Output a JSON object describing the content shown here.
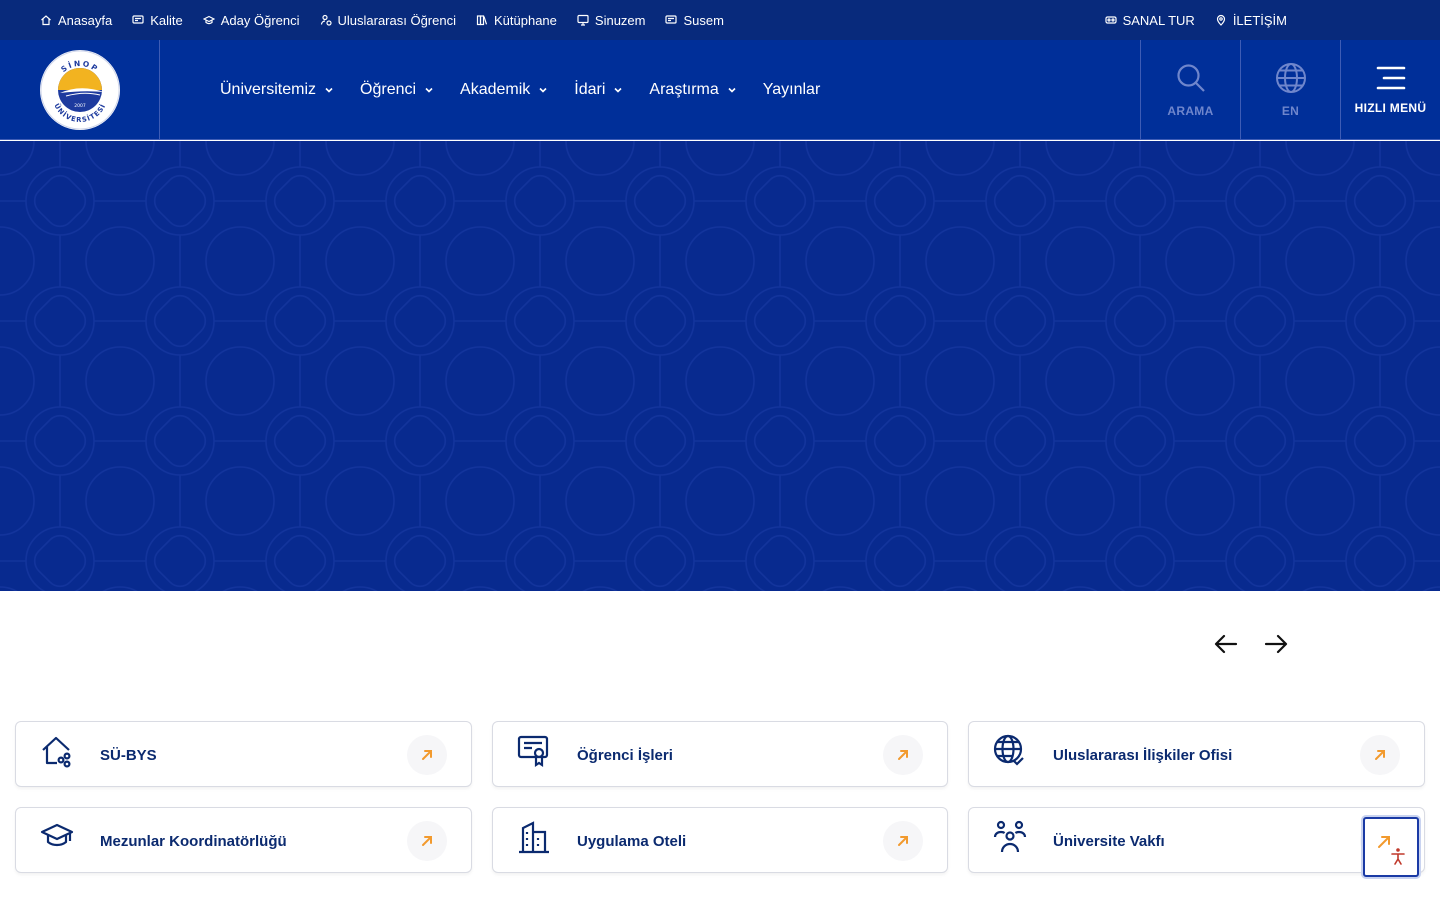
{
  "topbar": {
    "left": [
      {
        "label": "Anasayfa",
        "icon": "home-icon"
      },
      {
        "label": "Kalite",
        "icon": "certificate-icon"
      },
      {
        "label": "Aday Öğrenci",
        "icon": "graduation-cap-icon"
      },
      {
        "label": "Uluslararası Öğrenci",
        "icon": "user-globe-icon"
      },
      {
        "label": "Kütüphane",
        "icon": "books-icon"
      },
      {
        "label": "Sinuzem",
        "icon": "monitor-icon"
      },
      {
        "label": "Susem",
        "icon": "certificate-icon"
      }
    ],
    "right": [
      {
        "label": "SANAL TUR",
        "icon": "vr-glasses-icon"
      },
      {
        "label": "İLETİŞİM",
        "icon": "location-pin-icon"
      }
    ]
  },
  "header": {
    "logo": {
      "top_text": "SİNOP",
      "bottom_text": "ÜNİVERSİTESİ",
      "year": "2007"
    },
    "nav": [
      {
        "label": "Üniversitemiz",
        "has_dropdown": true
      },
      {
        "label": "Öğrenci",
        "has_dropdown": true
      },
      {
        "label": "Akademik",
        "has_dropdown": true
      },
      {
        "label": "İdari",
        "has_dropdown": true
      },
      {
        "label": "Araştırma",
        "has_dropdown": true
      },
      {
        "label": "Yayınlar",
        "has_dropdown": false
      }
    ],
    "search_label": "ARAMA",
    "lang_label": "EN",
    "menu_label": "HIZLI MENÜ"
  },
  "colors": {
    "primary": "#002f99",
    "topbar": "#082a7c",
    "hero": "#082a8f",
    "card_text": "#0b2a6f",
    "accent": "#f29a2e"
  },
  "quick_links": [
    {
      "label": "SÜ-BYS",
      "icon": "home-share-icon"
    },
    {
      "label": "Öğrenci İşleri",
      "icon": "certificate-icon"
    },
    {
      "label": "Uluslararası İlişkiler Ofisi",
      "icon": "globe-check-icon"
    },
    {
      "label": "Mezunlar Koordinatörlüğü",
      "icon": "graduation-cap-icon"
    },
    {
      "label": "Uygulama Oteli",
      "icon": "building-icon"
    },
    {
      "label": "Üniversite Vakfı",
      "icon": "people-group-icon"
    }
  ]
}
